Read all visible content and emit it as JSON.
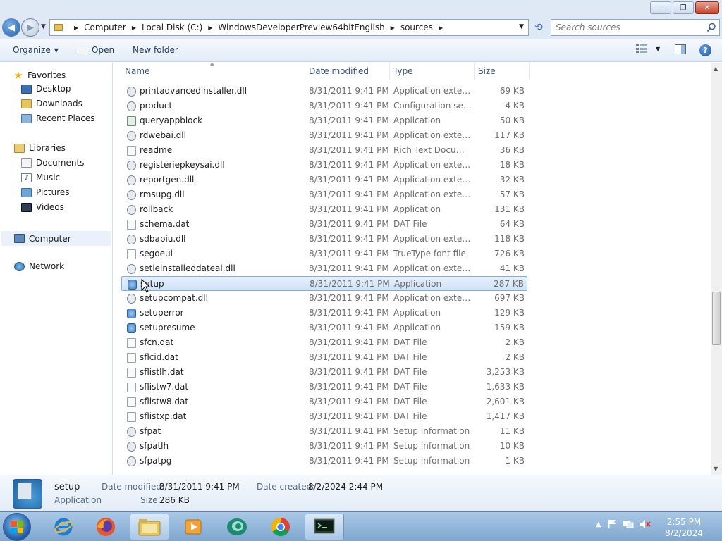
{
  "window": {
    "minimize_glyph": "—",
    "maximize_glyph": "❐",
    "close_glyph": "✕"
  },
  "address": {
    "crumbs": [
      "Computer",
      "Local Disk (C:)",
      "WindowsDeveloperPreview64bitEnglish",
      "sources"
    ],
    "search_placeholder": "Search sources"
  },
  "toolbar": {
    "organize": "Organize",
    "open": "Open",
    "new_folder": "New folder"
  },
  "navigation": {
    "favorites": "Favorites",
    "desktop": "Desktop",
    "downloads": "Downloads",
    "recent_places": "Recent Places",
    "libraries": "Libraries",
    "documents": "Documents",
    "music": "Music",
    "pictures": "Pictures",
    "videos": "Videos",
    "computer": "Computer",
    "network": "Network"
  },
  "columns": {
    "name": "Name",
    "date": "Date modified",
    "type": "Type",
    "size": "Size"
  },
  "files": [
    {
      "name": "printadvancedinstaller.dll",
      "date": "8/31/2011 9:41 PM",
      "type": "Application extens...",
      "size": "69 KB",
      "icon": "gear"
    },
    {
      "name": "product",
      "date": "8/31/2011 9:41 PM",
      "type": "Configuration sett...",
      "size": "4 KB",
      "icon": "gear"
    },
    {
      "name": "queryappblock",
      "date": "8/31/2011 9:41 PM",
      "type": "Application",
      "size": "50 KB",
      "icon": "app"
    },
    {
      "name": "rdwebai.dll",
      "date": "8/31/2011 9:41 PM",
      "type": "Application extens...",
      "size": "117 KB",
      "icon": "gear"
    },
    {
      "name": "readme",
      "date": "8/31/2011 9:41 PM",
      "type": "Rich Text Docume...",
      "size": "36 KB",
      "icon": "doc"
    },
    {
      "name": "registeriepkeysai.dll",
      "date": "8/31/2011 9:41 PM",
      "type": "Application extens...",
      "size": "18 KB",
      "icon": "gear"
    },
    {
      "name": "reportgen.dll",
      "date": "8/31/2011 9:41 PM",
      "type": "Application extens...",
      "size": "32 KB",
      "icon": "gear"
    },
    {
      "name": "rmsupg.dll",
      "date": "8/31/2011 9:41 PM",
      "type": "Application extens...",
      "size": "57 KB",
      "icon": "gear"
    },
    {
      "name": "rollback",
      "date": "8/31/2011 9:41 PM",
      "type": "Application",
      "size": "131 KB",
      "icon": "gear"
    },
    {
      "name": "schema.dat",
      "date": "8/31/2011 9:41 PM",
      "type": "DAT File",
      "size": "64 KB",
      "icon": "blank"
    },
    {
      "name": "sdbapiu.dll",
      "date": "8/31/2011 9:41 PM",
      "type": "Application extens...",
      "size": "118 KB",
      "icon": "gear"
    },
    {
      "name": "segoeui",
      "date": "8/31/2011 9:41 PM",
      "type": "TrueType font file",
      "size": "726 KB",
      "icon": "font"
    },
    {
      "name": "setieinstalleddateai.dll",
      "date": "8/31/2011 9:41 PM",
      "type": "Application extens...",
      "size": "41 KB",
      "icon": "gear"
    },
    {
      "name": "setup",
      "date": "8/31/2011 9:41 PM",
      "type": "Application",
      "size": "287 KB",
      "icon": "setup"
    },
    {
      "name": "setupcompat.dll",
      "date": "8/31/2011 9:41 PM",
      "type": "Application extens...",
      "size": "697 KB",
      "icon": "gear"
    },
    {
      "name": "setuperror",
      "date": "8/31/2011 9:41 PM",
      "type": "Application",
      "size": "129 KB",
      "icon": "setup"
    },
    {
      "name": "setupresume",
      "date": "8/31/2011 9:41 PM",
      "type": "Application",
      "size": "159 KB",
      "icon": "setup"
    },
    {
      "name": "sfcn.dat",
      "date": "8/31/2011 9:41 PM",
      "type": "DAT File",
      "size": "2 KB",
      "icon": "blank"
    },
    {
      "name": "sflcid.dat",
      "date": "8/31/2011 9:41 PM",
      "type": "DAT File",
      "size": "2 KB",
      "icon": "blank"
    },
    {
      "name": "sflistlh.dat",
      "date": "8/31/2011 9:41 PM",
      "type": "DAT File",
      "size": "3,253 KB",
      "icon": "blank"
    },
    {
      "name": "sflistw7.dat",
      "date": "8/31/2011 9:41 PM",
      "type": "DAT File",
      "size": "1,633 KB",
      "icon": "blank"
    },
    {
      "name": "sflistw8.dat",
      "date": "8/31/2011 9:41 PM",
      "type": "DAT File",
      "size": "2,601 KB",
      "icon": "blank"
    },
    {
      "name": "sflistxp.dat",
      "date": "8/31/2011 9:41 PM",
      "type": "DAT File",
      "size": "1,417 KB",
      "icon": "blank"
    },
    {
      "name": "sfpat",
      "date": "8/31/2011 9:41 PM",
      "type": "Setup Information",
      "size": "11 KB",
      "icon": "gear"
    },
    {
      "name": "sfpatlh",
      "date": "8/31/2011 9:41 PM",
      "type": "Setup Information",
      "size": "10 KB",
      "icon": "gear"
    },
    {
      "name": "sfpatpg",
      "date": "8/31/2011 9:41 PM",
      "type": "Setup Information",
      "size": "1 KB",
      "icon": "gear"
    }
  ],
  "selected_file_index": 13,
  "details": {
    "name": "setup",
    "kind": "Application",
    "date_modified_label": "Date modified:",
    "date_modified": "8/31/2011 9:41 PM",
    "date_created_label": "Date created:",
    "date_created": "8/2/2024 2:44 PM",
    "size_label": "Size:",
    "size": "286 KB"
  },
  "clock": {
    "time": "2:55 PM",
    "date": "8/2/2024"
  },
  "colors": {
    "chrome": "#dfe9f5",
    "selection": "#cfe2f8",
    "taskbar": "#7fa6cf"
  },
  "icons": [
    "back-icon",
    "forward-icon",
    "refresh-icon",
    "search-icon",
    "help-icon",
    "start-icon",
    "ie-icon",
    "firefox-icon",
    "explorer-icon",
    "media-icon",
    "cortana-icon",
    "chrome-icon",
    "cmd-icon"
  ]
}
